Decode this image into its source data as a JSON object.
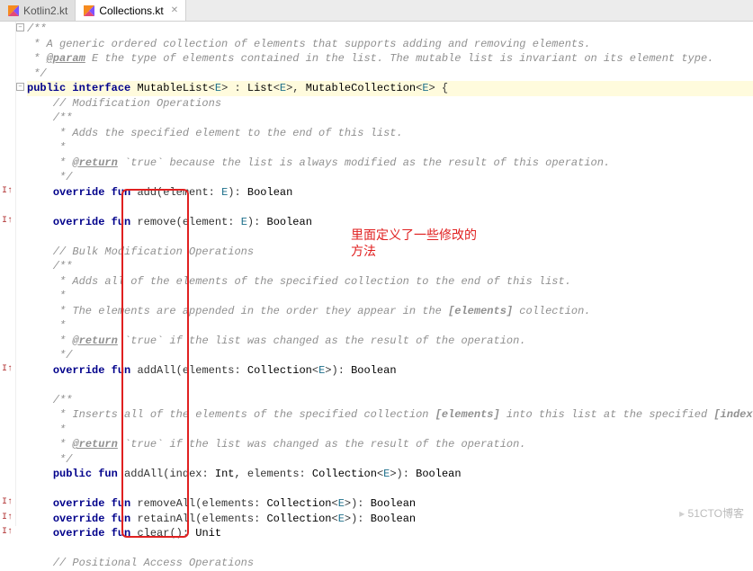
{
  "tabs": [
    {
      "label": "Kotlin2.kt",
      "active": false
    },
    {
      "label": "Collections.kt",
      "active": true
    }
  ],
  "code": {
    "lines": [
      {
        "t": "c",
        "text": "/**"
      },
      {
        "t": "c",
        "text": " * A generic ordered collection of elements that supports adding and removing elements."
      },
      {
        "t": "cp",
        "prefix": " * ",
        "tag": "@param",
        "rest": " E the type of elements contained in the list. The mutable list is invariant on its element type."
      },
      {
        "t": "c",
        "text": " */"
      },
      {
        "t": "decl",
        "hl": true,
        "tokens": [
          "public",
          " ",
          "interface",
          " ",
          "MutableList",
          "<",
          "E",
          ">",
          " : ",
          "List",
          "<",
          "E",
          ">",
          ", ",
          "MutableCollection",
          "<",
          "E",
          "> {"
        ]
      },
      {
        "t": "c",
        "text": "    // Modification Operations"
      },
      {
        "t": "c",
        "text": "    /**"
      },
      {
        "t": "c",
        "text": "     * Adds the specified element to the end of this list."
      },
      {
        "t": "c",
        "text": "     *"
      },
      {
        "t": "cp",
        "prefix": "     * ",
        "tag": "@return",
        "rest": " `true` because the list is always modified as the result of this operation."
      },
      {
        "t": "c",
        "text": "     */"
      },
      {
        "t": "fn",
        "mark": "I",
        "tokens": [
          "    ",
          "override",
          " ",
          "fun",
          " ",
          "add",
          "(",
          "element",
          ": ",
          "E",
          "): ",
          "Boolean"
        ]
      },
      {
        "t": "blank"
      },
      {
        "t": "fn",
        "mark": "I",
        "tokens": [
          "    ",
          "override",
          " ",
          "fun",
          " ",
          "remove",
          "(",
          "element",
          ": ",
          "E",
          "): ",
          "Boolean"
        ]
      },
      {
        "t": "blank"
      },
      {
        "t": "c",
        "text": "    // Bulk Modification Operations"
      },
      {
        "t": "c",
        "text": "    /**"
      },
      {
        "t": "c",
        "text": "     * Adds all of the elements of the specified collection to the end of this list."
      },
      {
        "t": "c",
        "text": "     *"
      },
      {
        "t": "cb",
        "prefix": "     * The elements are appended in the order they appear in the ",
        "bold": "[elements]",
        "rest": " collection."
      },
      {
        "t": "c",
        "text": "     *"
      },
      {
        "t": "cp",
        "prefix": "     * ",
        "tag": "@return",
        "rest": " `true` if the list was changed as the result of the operation."
      },
      {
        "t": "c",
        "text": "     */"
      },
      {
        "t": "fn",
        "mark": "I",
        "tokens": [
          "    ",
          "override",
          " ",
          "fun",
          " ",
          "addAll",
          "(",
          "elements",
          ": ",
          "Collection",
          "<",
          "E",
          ">",
          "): ",
          "Boolean"
        ]
      },
      {
        "t": "blank"
      },
      {
        "t": "c",
        "text": "    /**"
      },
      {
        "t": "cb2",
        "prefix": "     * Inserts all of the elements of the specified collection ",
        "b1": "[elements]",
        "mid": " into this list at the specified ",
        "b2": "[index]",
        "rest": "."
      },
      {
        "t": "c",
        "text": "     *"
      },
      {
        "t": "cp",
        "prefix": "     * ",
        "tag": "@return",
        "rest": " `true` if the list was changed as the result of the operation."
      },
      {
        "t": "c",
        "text": "     */"
      },
      {
        "t": "fn",
        "mark": "",
        "tokens": [
          "    ",
          "public",
          " ",
          "fun",
          " ",
          "addAll",
          "(",
          "index",
          ": ",
          "Int",
          ", ",
          "elements",
          ": ",
          "Collection",
          "<",
          "E",
          ">",
          "): ",
          "Boolean"
        ]
      },
      {
        "t": "blank"
      },
      {
        "t": "fn",
        "mark": "I",
        "tokens": [
          "    ",
          "override",
          " ",
          "fun",
          " ",
          "removeAll",
          "(",
          "elements",
          ": ",
          "Collection",
          "<",
          "E",
          ">",
          "): ",
          "Boolean"
        ]
      },
      {
        "t": "fn",
        "mark": "I",
        "tokens": [
          "    ",
          "override",
          " ",
          "fun",
          " ",
          "retainAll",
          "(",
          "elements",
          ": ",
          "Collection",
          "<",
          "E",
          ">",
          "): ",
          "Boolean"
        ]
      },
      {
        "t": "fn",
        "mark": "I",
        "tokens": [
          "    ",
          "override",
          " ",
          "fun",
          " ",
          "clear",
          "(): ",
          "Unit"
        ]
      },
      {
        "t": "blank"
      },
      {
        "t": "c",
        "text": "    // Positional Access Operations"
      }
    ]
  },
  "annotation": {
    "line1": "里面定义了一些修改的",
    "line2": "方法"
  },
  "watermark": "51CTO博客"
}
